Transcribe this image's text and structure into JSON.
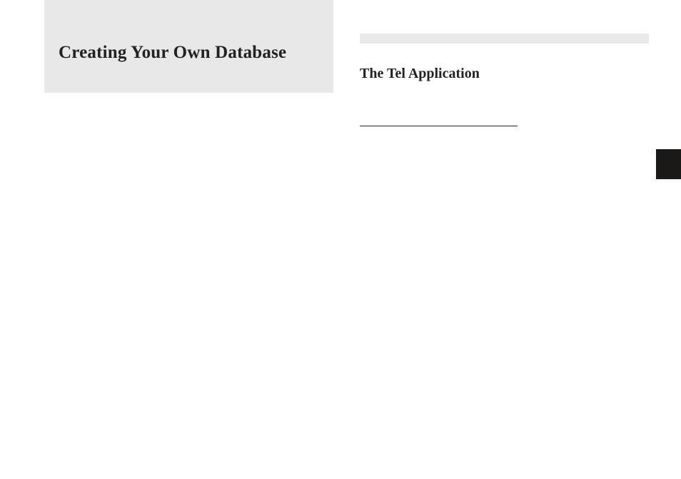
{
  "left": {
    "title": "Creating Your Own Database"
  },
  "right": {
    "subtitle": "The Tel Application"
  }
}
